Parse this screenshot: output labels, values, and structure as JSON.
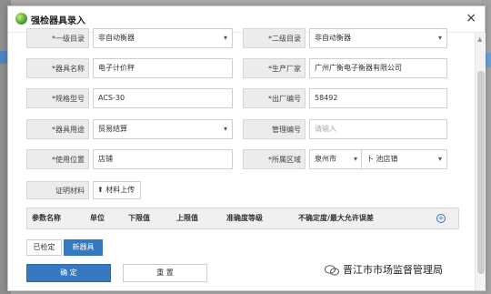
{
  "dialog": {
    "title": "强检器具录入",
    "close": "×"
  },
  "form": {
    "level1_label": "*一级目录",
    "level1_value": "非自动衡器",
    "level2_label": "*二级目录",
    "level2_value": "非自动衡器",
    "name_label": "*器具名称",
    "name_value": "电子计价秤",
    "maker_label": "*生产厂家",
    "maker_value": "广州广衡电子衡器有限公司",
    "model_label": "*规格型号",
    "model_value": "ACS-30",
    "serial_label": "*出厂编号",
    "serial_value": "58492",
    "usage_label": "*器具用途",
    "usage_value": "贸易结算",
    "mgmt_label": "管理编号",
    "mgmt_placeholder": "请输入",
    "location_label": "*使用位置",
    "location_value": "店铺",
    "region_label": "*所属区域",
    "region_city": "泉州市",
    "region_district": "卜 池店镇",
    "proof_label": "证明材料",
    "upload_label": "材料上传"
  },
  "table": {
    "headers": [
      "参数名称",
      "单位",
      "下限值",
      "上限值",
      "准确度等级",
      "不确定度/最大允许误差"
    ],
    "add_icon": "plus-circle-icon"
  },
  "tabs": {
    "checked": "已检定",
    "new": "新器具"
  },
  "buttons": {
    "confirm": "确 定",
    "reset": "重 置"
  },
  "watermark": {
    "text": "晋江市市场监督管理局"
  },
  "colors": {
    "primary": "#3679c0",
    "accent": "#2a78c6"
  }
}
